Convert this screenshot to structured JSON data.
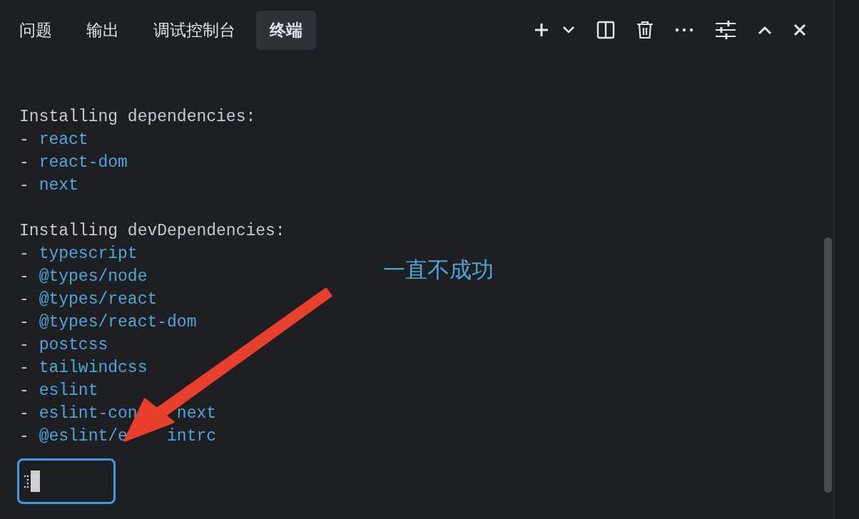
{
  "tabs": [
    {
      "label": "问题",
      "selected": false
    },
    {
      "label": "输出",
      "selected": false
    },
    {
      "label": "调试控制台",
      "selected": false
    },
    {
      "label": "终端",
      "selected": true
    }
  ],
  "terminal": {
    "lines": [
      {
        "kind": "text",
        "text": "Installing dependencies:"
      },
      {
        "kind": "item",
        "bullet": "-",
        "text": "react"
      },
      {
        "kind": "item",
        "bullet": "-",
        "text": "react-dom"
      },
      {
        "kind": "item",
        "bullet": "-",
        "text": "next"
      },
      {
        "kind": "blank"
      },
      {
        "kind": "text",
        "text": "Installing devDependencies:"
      },
      {
        "kind": "item",
        "bullet": "-",
        "text": "typescript"
      },
      {
        "kind": "item",
        "bullet": "-",
        "text": "@types/node"
      },
      {
        "kind": "item",
        "bullet": "-",
        "text": "@types/react"
      },
      {
        "kind": "item",
        "bullet": "-",
        "text": "@types/react-dom"
      },
      {
        "kind": "item",
        "bullet": "-",
        "text": "postcss"
      },
      {
        "kind": "item",
        "bullet": "-",
        "text": "tailwindcss"
      },
      {
        "kind": "item",
        "bullet": "-",
        "text": "eslint"
      },
      {
        "kind": "covered",
        "bullet": "-",
        "parts": [
          "eslint-con",
          "next"
        ]
      },
      {
        "kind": "covered",
        "bullet": "-",
        "parts": [
          "@eslint/e",
          "intrc"
        ]
      }
    ]
  },
  "annotation": {
    "text": "一直不成功"
  }
}
